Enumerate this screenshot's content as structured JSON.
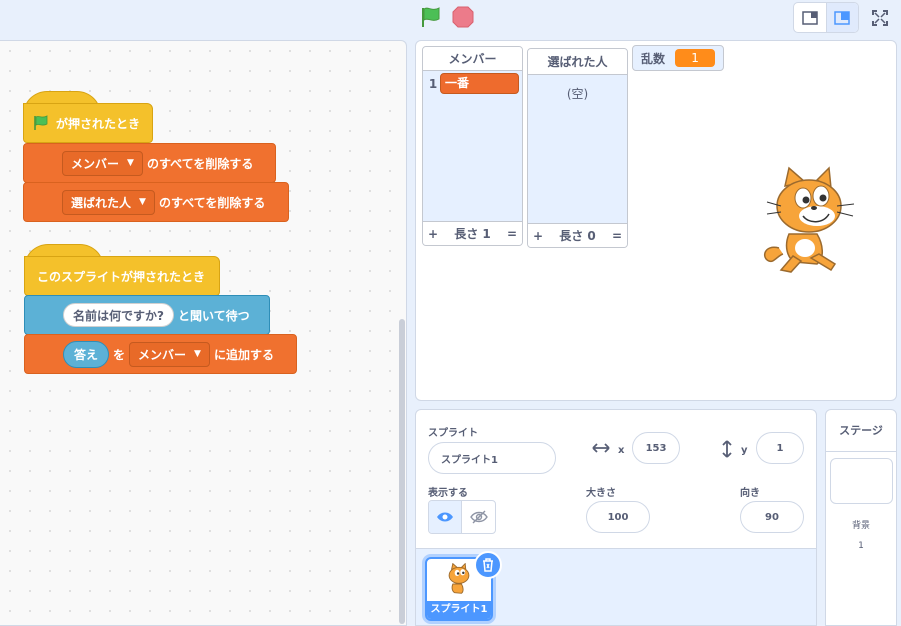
{
  "toolbar": {
    "green_flag": "green-flag-icon",
    "stop": "stop-icon",
    "layout_small": "small-stage-icon",
    "layout_normal": "normal-stage-icon",
    "fullscreen": "fullscreen-icon"
  },
  "scripts": {
    "script1": {
      "hat_label": "が押されたとき",
      "b1": {
        "dropdown": "メンバー",
        "text": "のすべてを削除する"
      },
      "b2": {
        "dropdown": "選ばれた人",
        "text": "のすべてを削除する"
      }
    },
    "script2": {
      "hat_label": "このスプライトが押されたとき",
      "ask": {
        "input": "名前は何ですか?",
        "text": "と聞いて待つ"
      },
      "add": {
        "reporter": "答え",
        "mid": "を",
        "dropdown": "メンバー",
        "text": "に追加する"
      }
    }
  },
  "stage": {
    "list_members": {
      "title": "メンバー",
      "items": [
        {
          "index": "1",
          "value": "一番"
        }
      ],
      "plus": "+",
      "length_label": "長さ 1",
      "resize": "="
    },
    "list_chosen": {
      "title": "選ばれた人",
      "empty": "(空)",
      "plus": "+",
      "length_label": "長さ 0",
      "resize": "="
    },
    "variable": {
      "name": "乱数",
      "value": "1"
    }
  },
  "sprite_info": {
    "sprite_label": "スプライト",
    "sprite_name": "スプライト1",
    "x_label": "x",
    "x_value": "153",
    "y_label": "y",
    "y_value": "1",
    "show_label": "表示する",
    "size_label": "大きさ",
    "size_value": "100",
    "direction_label": "向き",
    "direction_value": "90"
  },
  "sprite_list": {
    "items": [
      {
        "name": "スプライト1"
      }
    ]
  },
  "stage_panel": {
    "title": "ステージ",
    "backdrop_label": "背景",
    "backdrop_count": "1"
  },
  "colors": {
    "motion_orange": "#f0712f",
    "events_yellow": "#f4c12b",
    "sensing_blue": "#5cb1d6",
    "accent_blue": "#4c97ff"
  }
}
